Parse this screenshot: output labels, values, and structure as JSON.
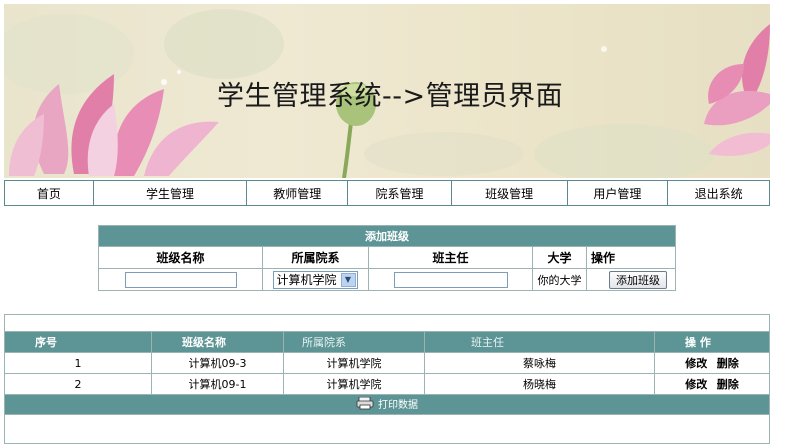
{
  "banner": {
    "title": "学生管理系统-->管理员界面"
  },
  "nav": [
    {
      "label": "首页"
    },
    {
      "label": "学生管理"
    },
    {
      "label": "教师管理"
    },
    {
      "label": "院系管理"
    },
    {
      "label": "班级管理"
    },
    {
      "label": "用户管理"
    },
    {
      "label": "退出系统"
    }
  ],
  "add_form": {
    "title": "添加班级",
    "headers": {
      "class_name": "班级名称",
      "department": "所属院系",
      "head_teacher": "班主任",
      "university": "大学",
      "operation": "操作"
    },
    "class_name_value": "",
    "department_selected": "计算机学院",
    "head_teacher_value": "",
    "university_value": "你的大学",
    "submit_label": "添加班级"
  },
  "list": {
    "columns": [
      "序号",
      "班级名称",
      "所属院系",
      "班主任",
      "操 作"
    ],
    "rows": [
      {
        "index": "1",
        "class_name": "计算机09-3",
        "department": "计算机学院",
        "head_teacher": "蔡咏梅",
        "edit": "修改",
        "delete": "删除"
      },
      {
        "index": "2",
        "class_name": "计算机09-1",
        "department": "计算机学院",
        "head_teacher": "杨晓梅",
        "edit": "修改",
        "delete": "删除"
      }
    ],
    "print_label": "打印数据"
  },
  "colors": {
    "header_teal": "#5d9596",
    "border": "#9cb3b4",
    "banner_bg": "#ece5ca",
    "lotus_pink": "#e27aa8"
  }
}
